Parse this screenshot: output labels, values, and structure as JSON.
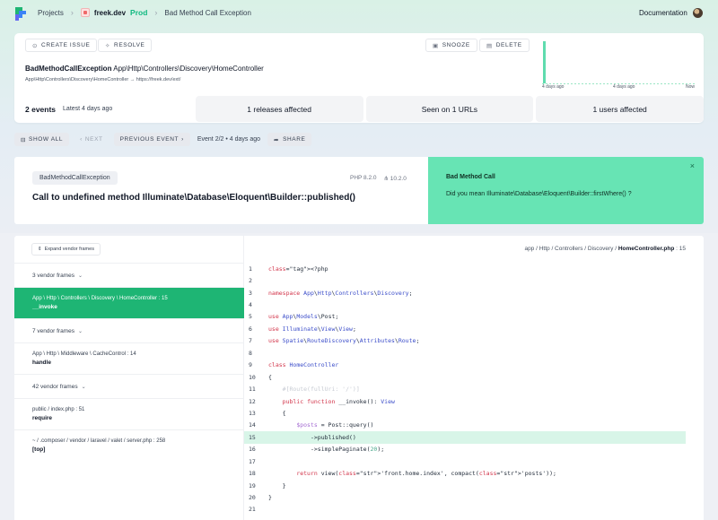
{
  "nav": {
    "crumbs": [
      {
        "label": "Projects"
      },
      {
        "label": "freek.dev",
        "env": "Prod"
      },
      {
        "label": "Bad Method Call Exception"
      }
    ],
    "documentation": "Documentation"
  },
  "actions": {
    "create_issue": "CREATE ISSUE",
    "resolve": "RESOLVE",
    "snooze": "SNOOZE",
    "delete": "DELETE"
  },
  "error": {
    "class": "BadMethodCallException",
    "location": "App\\Http\\Controllers\\Discovery\\HomeController",
    "sub_location": "App\\Http\\Controllers\\Discovery\\HomeController",
    "url": "https://freek.dev/ext/"
  },
  "chart_data": {
    "type": "bar",
    "categories": [
      "4 days ago",
      "4 days ago",
      "Now"
    ],
    "values": [
      2,
      0,
      0
    ],
    "title": "",
    "xlabel": "",
    "ylabel": "",
    "ylim": [
      0,
      2
    ]
  },
  "stats": {
    "events_count": "2 events",
    "events_latest": "Latest 4 days ago",
    "releases": "1 releases affected",
    "urls": "Seen on 1 URLs",
    "users": "1 users affected"
  },
  "event_nav": {
    "show_all": "SHOW ALL",
    "next": "NEXT",
    "previous": "PREVIOUS EVENT",
    "position": "Event 2/2 • 4 days ago",
    "share": "SHARE"
  },
  "exception": {
    "tag": "BadMethodCallException",
    "php": "PHP 8.2.0",
    "laravel": "10.2.0",
    "message": "Call to undefined method Illuminate\\Database\\Eloquent\\Builder::published()"
  },
  "solution": {
    "title": "Bad Method Call",
    "text": "Did you mean Illuminate\\Database\\Eloquent\\Builder::firstWhere() ?"
  },
  "frames": {
    "expand_label": "Expand vendor frames",
    "items": [
      {
        "kind": "vendor",
        "label": "3 vendor frames"
      },
      {
        "kind": "app",
        "path": "App \\ Http \\ Controllers \\ Discovery \\ HomeController : 15",
        "method": "__invoke",
        "active": true
      },
      {
        "kind": "vendor",
        "label": "7 vendor frames"
      },
      {
        "kind": "app",
        "path": "App \\ Http \\ Middleware \\ CacheControl : 14",
        "method": "handle"
      },
      {
        "kind": "vendor",
        "label": "42 vendor frames"
      },
      {
        "kind": "app",
        "path": "public / index.php : 51",
        "method": "require"
      },
      {
        "kind": "app",
        "path": "~ / .composer / vendor / laravel / valet / server.php : 258",
        "method": "[top]"
      }
    ]
  },
  "code": {
    "path_prefix": "app / Http / Controllers / Discovery / ",
    "path_file": "HomeController.php",
    "path_line": " : 15",
    "highlight_line": 15,
    "lines": [
      {
        "n": "1",
        "t": "<?php"
      },
      {
        "n": "2",
        "t": ""
      },
      {
        "n": "3",
        "t": "namespace App\\Http\\Controllers\\Discovery;"
      },
      {
        "n": "4",
        "t": ""
      },
      {
        "n": "5",
        "t": "use App\\Models\\Post;"
      },
      {
        "n": "6",
        "t": "use Illuminate\\View\\View;"
      },
      {
        "n": "7",
        "t": "use Spatie\\RouteDiscovery\\Attributes\\Route;"
      },
      {
        "n": "8",
        "t": ""
      },
      {
        "n": "9",
        "t": "class HomeController"
      },
      {
        "n": "10",
        "t": "{"
      },
      {
        "n": "11",
        "t": "    #[Route(fullUri: '/')]"
      },
      {
        "n": "12",
        "t": "    public function __invoke(): View"
      },
      {
        "n": "13",
        "t": "    {"
      },
      {
        "n": "14",
        "t": "        $posts = Post::query()"
      },
      {
        "n": "15",
        "t": "            ->published()"
      },
      {
        "n": "16",
        "t": "            ->simplePaginate(20);"
      },
      {
        "n": "17",
        "t": ""
      },
      {
        "n": "18",
        "t": "        return view('front.home.index', compact('posts'));"
      },
      {
        "n": "19",
        "t": "    }"
      },
      {
        "n": "20",
        "t": "}"
      },
      {
        "n": "21",
        "t": ""
      }
    ]
  },
  "colors": {
    "accent": "#1eb574",
    "solution_bg": "#67e4b4",
    "highlight_line": "#d8f5e8",
    "env": "#10b981"
  }
}
